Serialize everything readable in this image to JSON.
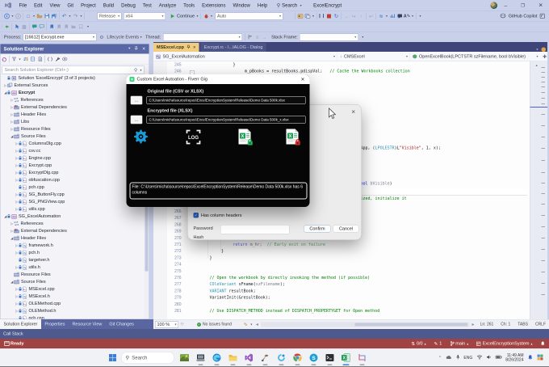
{
  "window": {
    "menus": [
      "File",
      "Edit",
      "View",
      "Git",
      "Project",
      "Build",
      "Debug",
      "Test",
      "Analyze",
      "Tools",
      "Extensions",
      "Window",
      "Help"
    ],
    "search_label": "Search",
    "solution_name": "ExcelEncrypt",
    "copilot_label": "GitHub Copilot"
  },
  "toolbar": {
    "configuration": "Release",
    "platform": "x64",
    "continue_label": "Continue",
    "auto_label": "Auto"
  },
  "debug_location": {
    "process_label": "Process:",
    "process_value": "[16612] Excrypt.exe",
    "lifecycle_label": "Lifecycle Events",
    "thread_label": "Thread:",
    "stack_frame_label": "Stack Frame:"
  },
  "solution_explorer": {
    "title": "Solution Explorer",
    "search_placeholder": "Search Solution Explorer (Ctrl+;)",
    "tree": [
      {
        "label": "Solution 'ExcelEncrypt' (3 of 3 projects)",
        "type": "solution",
        "level": 0,
        "lock": true
      },
      {
        "label": "External Sources",
        "type": "extsrc",
        "level": 1,
        "exp": "r"
      },
      {
        "label": "Excrypt",
        "type": "project",
        "level": 1,
        "exp": "d",
        "bold": true,
        "lock": true
      },
      {
        "label": "References",
        "type": "refs",
        "level": 2,
        "exp": "r"
      },
      {
        "label": "External Dependencies",
        "type": "deps",
        "level": 2,
        "exp": "r"
      },
      {
        "label": "Header Files",
        "type": "folder",
        "level": 2,
        "exp": "r"
      },
      {
        "label": "Libs",
        "type": "folder",
        "level": 2,
        "exp": "r"
      },
      {
        "label": "Resource Files",
        "type": "folder",
        "level": 2,
        "exp": "r"
      },
      {
        "label": "Source Files",
        "type": "folder",
        "level": 2,
        "exp": "d"
      },
      {
        "label": "ColumnsDlg.cpp",
        "type": "cpp",
        "level": 3,
        "exp": "r",
        "lock": true
      },
      {
        "label": "csv.cc",
        "type": "cpp",
        "level": 3,
        "exp": "r",
        "lock": true
      },
      {
        "label": "Engine.cpp",
        "type": "cpp",
        "level": 3,
        "exp": "r",
        "lock": true
      },
      {
        "label": "Excrypt.cpp",
        "type": "cpp",
        "level": 3,
        "exp": "r",
        "lock": true
      },
      {
        "label": "ExcryptDlg.cpp",
        "type": "cpp",
        "level": 3,
        "exp": "r",
        "lock": true
      },
      {
        "label": "obfuscation.cpp",
        "type": "cpp",
        "level": 3,
        "exp": "r",
        "lock": true
      },
      {
        "label": "pch.cpp",
        "type": "cpp",
        "level": 3,
        "lock": true
      },
      {
        "label": "SG_ButtonFly.cpp",
        "type": "cpp",
        "level": 3,
        "exp": "r",
        "lock": true
      },
      {
        "label": "SG_PNGView.cpp",
        "type": "cpp",
        "level": 3,
        "exp": "r",
        "lock": true
      },
      {
        "label": "utils.cpp",
        "type": "cpp",
        "level": 3,
        "exp": "r",
        "lock": true
      },
      {
        "label": "SG_ExcelAutomation",
        "type": "project",
        "level": 1,
        "exp": "d",
        "lock": true
      },
      {
        "label": "References",
        "type": "refs",
        "level": 2,
        "exp": "r"
      },
      {
        "label": "External Dependencies",
        "type": "deps",
        "level": 2,
        "exp": "r"
      },
      {
        "label": "Header Files",
        "type": "folder",
        "level": 2,
        "exp": "d"
      },
      {
        "label": "framework.h",
        "type": "h",
        "level": 3,
        "exp": "r",
        "lock": true
      },
      {
        "label": "pch.h",
        "type": "h",
        "level": 3,
        "exp": "r",
        "lock": true
      },
      {
        "label": "targetver.h",
        "type": "h",
        "level": 3,
        "lock": true
      },
      {
        "label": "utils.h",
        "type": "h",
        "level": 3,
        "exp": "r",
        "lock": true
      },
      {
        "label": "Resource Files",
        "type": "folder",
        "level": 2
      },
      {
        "label": "Source Files",
        "type": "folder",
        "level": 2,
        "exp": "d"
      },
      {
        "label": "MSExcel.cpp",
        "type": "cpp",
        "level": 3,
        "exp": "r",
        "lock": true
      },
      {
        "label": "MSExcel.h",
        "type": "h",
        "level": 3,
        "exp": "r",
        "lock": true
      },
      {
        "label": "OLEMethod.cpp",
        "type": "cpp",
        "level": 3,
        "exp": "r",
        "lock": true
      },
      {
        "label": "OLEMethod.h",
        "type": "h",
        "level": 3,
        "exp": "r",
        "lock": true
      },
      {
        "label": "pch.cpp",
        "type": "cpp",
        "level": 3,
        "lock": true
      }
    ]
  },
  "panel_tabs": [
    {
      "label": "Solution Explorer",
      "active": true
    },
    {
      "label": "Properties"
    },
    {
      "label": "Resource View"
    },
    {
      "label": "Git Changes"
    }
  ],
  "editor": {
    "tabs": [
      {
        "label": "MSExcel.cpp",
        "active": true
      },
      {
        "label": "Excrypt.rc - I...IALOG - Dialog"
      }
    ],
    "breadcrumb": {
      "project": "SG_ExcelAutomation",
      "class": "CMSExcel",
      "member": "OpenExcelBook(LPCTSTR szFilename, bool bVisible)"
    },
    "code": {
      "top_lines": [
        {
          "num": 245,
          "indent": 3,
          "segs": [
            [
              "p",
              "}"
            ]
          ]
        },
        {
          "num": 246,
          "indent": 4,
          "segs": [
            [
              "p",
              "m_pBooks = resultBooks.pdispVal;   "
            ],
            [
              "g",
              "// Cache the Workbooks collection"
            ]
          ]
        }
      ],
      "bottom_lines": [
        {
          "num": 265
        },
        {
          "num": 266
        },
        {
          "num": 267
        },
        {
          "num": 268
        },
        {
          "num": 269
        },
        {
          "num": 270
        },
        {
          "num": 271,
          "indent": 3,
          "segs": [
            [
              "b",
              "return"
            ],
            [
              "p",
              " m_hr;  "
            ],
            [
              "g",
              "// Early exit on failure"
            ]
          ],
          "faded": true
        },
        {
          "num": 272,
          "indent": 2,
          "segs": [
            [
              "p",
              "}"
            ]
          ]
        },
        {
          "num": 273,
          "indent": 1,
          "segs": [
            [
              "p",
              "}"
            ]
          ]
        },
        {
          "num": 274
        },
        {
          "num": 275
        },
        {
          "num": 276,
          "indent": 1,
          "segs": [
            [
              "g",
              "// Open the workbook by directly invoking the method (if possible)"
            ]
          ]
        },
        {
          "num": 277,
          "indent": 1,
          "segs": [
            [
              "t",
              "COleVariant"
            ],
            [
              "p",
              " sFname("
            ],
            [
              "gy",
              "szFilename"
            ],
            [
              "p",
              ");"
            ]
          ]
        },
        {
          "num": 278,
          "indent": 1,
          "segs": [
            [
              "t",
              "VARIANT"
            ],
            [
              "p",
              " resultBook;"
            ]
          ]
        },
        {
          "num": 279,
          "indent": 1,
          "segs": [
            [
              "p",
              "VariantInit(&resultBook);"
            ]
          ]
        },
        {
          "num": 280
        },
        {
          "num": 281,
          "indent": 1,
          "segs": [
            [
              "g",
              "// Use DISPATCH_METHOD instead of DISPATCH_PROPERTYGET for Open method"
            ]
          ]
        }
      ],
      "fragments": [
        {
          "segs": [
            [
              "p",
              "App, ("
            ],
            [
              "t",
              "LPOLESTR"
            ],
            [
              "p",
              ")L"
            ],
            [
              "r",
              "\"Visible\""
            ],
            [
              "p",
              ", 1, x);"
            ]
          ]
        },
        {
          "segs": [
            [
              "b",
              "ool"
            ],
            [
              "gy",
              " bVisible"
            ],
            [
              "p",
              ")"
            ]
          ]
        },
        {
          "segs": [
            [
              "g",
              "ized, initialize it"
            ]
          ]
        }
      ]
    }
  },
  "editor_bottom": {
    "zoom": "100 %",
    "health": "No issues found",
    "ln": "Ln: 261",
    "ch": "Ch: 1",
    "tabs": "TABS",
    "eol": "CRLF"
  },
  "call_stack": {
    "title": "Call Stack"
  },
  "status_bar": {
    "ready": "Ready",
    "sync_count": "0/0",
    "edit_count": "1",
    "branch": "main",
    "repo": "ExcelEncryptionSystem"
  },
  "dialog_black": {
    "title": "Custom Excel Autoation - Fiverr Gig",
    "original_label": "Original file (CSV or XLSX)",
    "original_path": "C:\\Users\\micha\\source\\repos\\ExcelEncryptionSystem\\Release\\Demo Data 500k.xlsx",
    "encrypted_label": "Encrypted file (XLSX)",
    "encrypted_path": "C:\\Users\\micha\\source\\repos\\ExcelEncryptionSystem\\Release\\Demo Data 500k_x.xlsx",
    "browse_label": "...",
    "log_label": "LOG",
    "message": "File: C:\\Users\\micha\\source\\repos\\ExcelEncryptionSystem\\Release\\Demo Data 500k.xlsx has 6 columns",
    "icons": [
      "settings-gear-icon",
      "log-icon",
      "excel-encrypt-icon",
      "excel-decrypt-icon"
    ]
  },
  "dialog_confirm": {
    "checkbox_label": "Has column headers",
    "checkbox_checked": true,
    "password_label": "Password",
    "password_value": "",
    "hash_label": "Hash",
    "confirm_label": "Confirm",
    "cancel_label": "Cancel"
  },
  "taskbar": {
    "search_label": "Search",
    "app_icons": [
      "photo-app-icon",
      "laptop-app-icon",
      "edge-icon",
      "file-explorer-icon",
      "visual-studio-icon",
      "build-tools-icon",
      "loop-app-icon",
      "chrome-icon",
      "skype-icon",
      "terminal-icon",
      "excel-icon",
      "snip-tool-icon"
    ],
    "active_app": "excel-icon",
    "tray_language": "ENG",
    "clock_time": "11:49 AM",
    "clock_date": "8/26/2024"
  },
  "colors": {
    "chrome": "#c9d0ea",
    "panel_header": "#5a67a5",
    "tabstrip": "#3f4578",
    "active_tab": "#f0cd81",
    "status_bar": "#a24343",
    "call_stack_bar": "#4e5a8e",
    "comment_green": "#008000",
    "type_teal": "#2B91AF",
    "keyword_blue": "#0000EE",
    "string_red": "#A31515",
    "gear_blue": "#1a9cd8",
    "excel_green": "#1e9e57",
    "lock_red": "#d42a2a"
  }
}
